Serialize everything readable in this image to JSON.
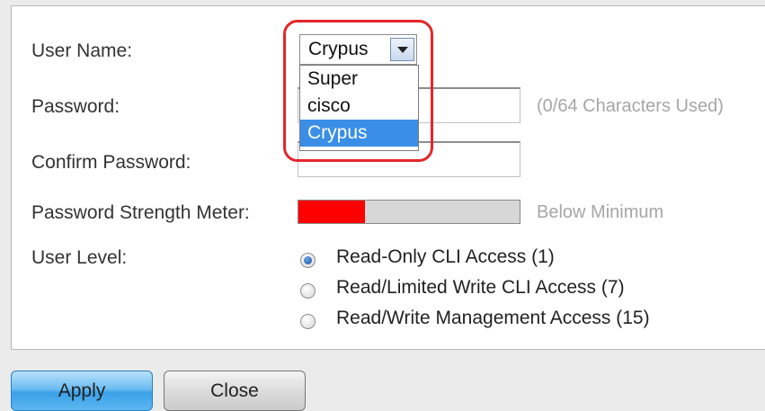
{
  "form": {
    "user_name_label": "User Name:",
    "password_label": "Password:",
    "confirm_password_label": "Confirm Password:",
    "strength_label": "Password Strength Meter:",
    "user_level_label": "User Level:",
    "password_hint": "(0/64 Characters Used)",
    "strength_text": "Below Minimum",
    "strength_fraction": 0.3,
    "strength_color": "#ff0000"
  },
  "user_select": {
    "value": "Crypus",
    "options": [
      "Super",
      "cisco",
      "Crypus"
    ],
    "selected_index": 2
  },
  "user_levels": [
    {
      "label": "Read-Only CLI Access (1)",
      "checked": true
    },
    {
      "label": "Read/Limited Write CLI Access (7)",
      "checked": false
    },
    {
      "label": "Read/Write Management Access (15)",
      "checked": false
    }
  ],
  "buttons": {
    "apply": "Apply",
    "close": "Close"
  },
  "colors": {
    "highlight": "#e4262b",
    "selected_option": "#3a8ee6"
  }
}
